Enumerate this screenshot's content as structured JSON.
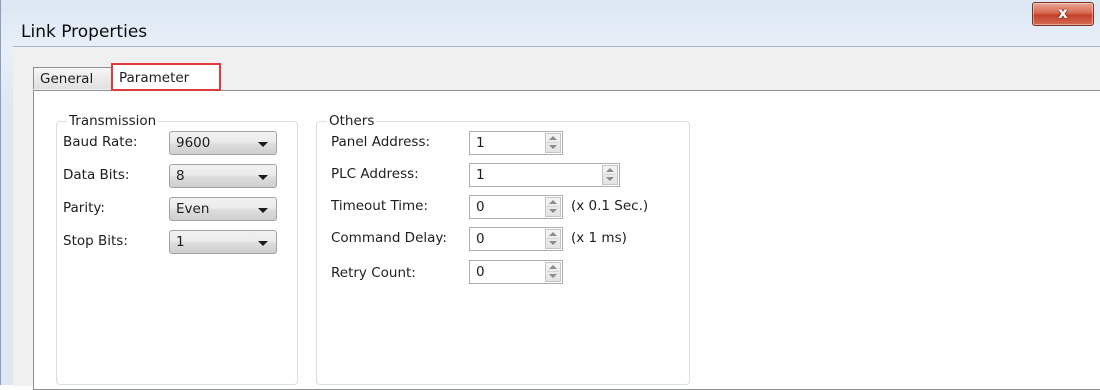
{
  "window": {
    "title": "Link Properties",
    "close_label": "x"
  },
  "tabs": {
    "general": "General",
    "parameter": "Parameter"
  },
  "transmission": {
    "legend": "Transmission",
    "baud_rate": {
      "label": "Baud Rate:",
      "value": "9600"
    },
    "data_bits": {
      "label": "Data Bits:",
      "value": "8"
    },
    "parity": {
      "label": "Parity:",
      "value": "Even"
    },
    "stop_bits": {
      "label": "Stop Bits:",
      "value": "1"
    }
  },
  "others": {
    "legend": "Others",
    "panel_address": {
      "label": "Panel Address:",
      "value": "1"
    },
    "plc_address": {
      "label": "PLC Address:",
      "value": "1"
    },
    "timeout_time": {
      "label": "Timeout Time:",
      "value": "0",
      "unit": "(x 0.1 Sec.)"
    },
    "command_delay": {
      "label": "Command Delay:",
      "value": "0",
      "unit": "(x 1 ms)"
    },
    "retry_count": {
      "label": "Retry Count:",
      "value": "0"
    }
  },
  "colors": {
    "selected_tab_border": "#e03a3a",
    "close_button": "#c6402a",
    "title_bar": "#dce7f3"
  },
  "icons": {
    "close": "close-icon",
    "dropdown": "chevron-down-icon",
    "spinner": "spinner-arrows-icon"
  }
}
